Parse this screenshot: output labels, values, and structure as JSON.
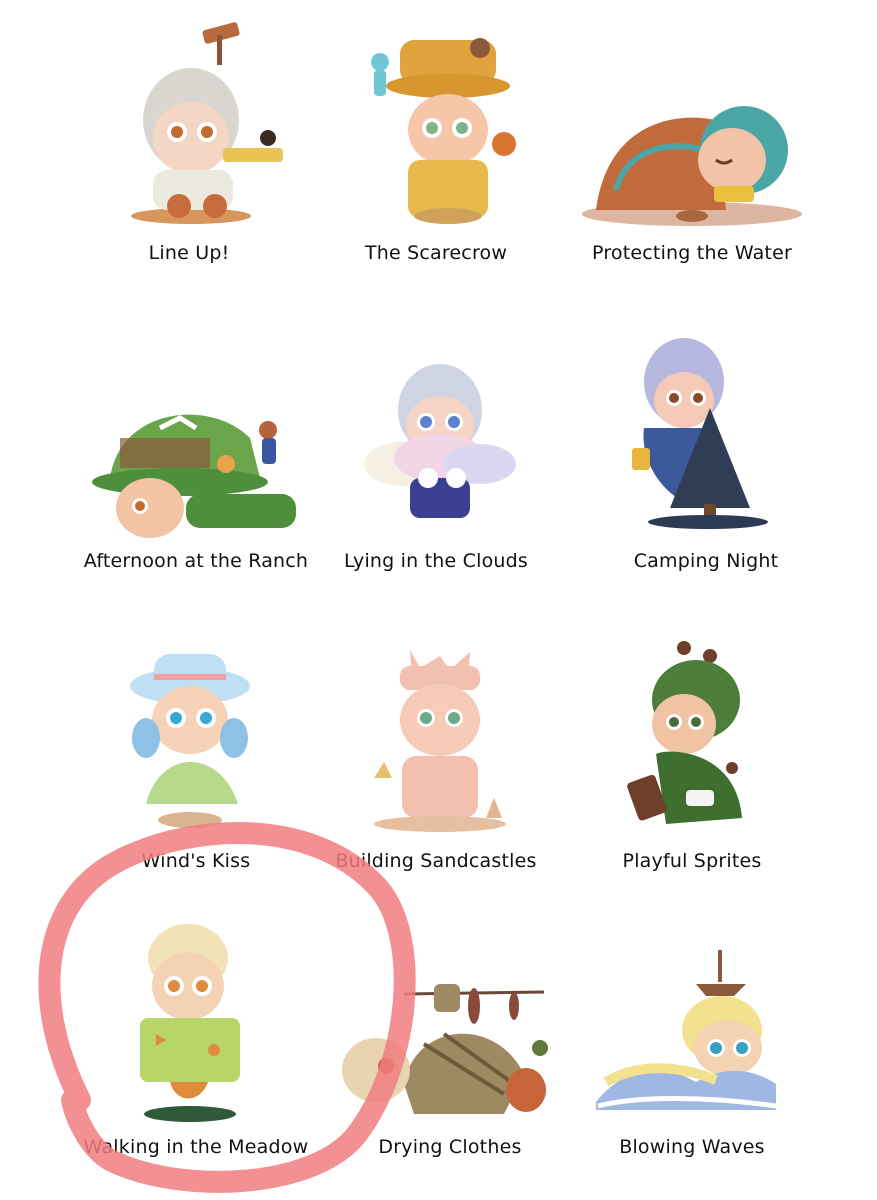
{
  "items": [
    {
      "label": "Line Up!",
      "figure": "line-up-figure",
      "colors": {
        "hair": "#d9d6cf",
        "body": "#eceadf",
        "accent": "#c46a2f"
      }
    },
    {
      "label": "The Scarecrow",
      "figure": "scarecrow-figure",
      "colors": {
        "hair": "#e0a23c",
        "body": "#e7b84b",
        "accent": "#8a6a3a"
      }
    },
    {
      "label": "Protecting the Water",
      "figure": "protecting-water-figure",
      "colors": {
        "hair": "#4aa7a6",
        "body": "#c16b3c",
        "accent": "#e9c13f"
      }
    },
    {
      "label": "Afternoon at the Ranch",
      "figure": "afternoon-ranch-figure",
      "colors": {
        "hair": "#6aa54b",
        "body": "#4f8f3c",
        "accent": "#8a5a3a"
      }
    },
    {
      "label": "Lying in the Clouds",
      "figure": "lying-clouds-figure",
      "colors": {
        "hair": "#cfd4e4",
        "body": "#f1d6e6",
        "accent": "#3b3f8f"
      }
    },
    {
      "label": "Camping Night",
      "figure": "camping-night-figure",
      "colors": {
        "hair": "#b7b8e0",
        "body": "#3c5a9a",
        "accent": "#2f3e55"
      }
    },
    {
      "label": "Wind's Kiss",
      "figure": "winds-kiss-figure",
      "colors": {
        "hair": "#bfe0f2",
        "body": "#b9d98a",
        "accent": "#8fc0e6"
      }
    },
    {
      "label": "Building Sandcastles",
      "figure": "building-sandcastles-figure",
      "colors": {
        "hair": "#f0b9a8",
        "body": "#f2c0ae",
        "accent": "#d9a36a"
      }
    },
    {
      "label": "Playful Sprites",
      "figure": "playful-sprites-figure",
      "colors": {
        "hair": "#4e7f3a",
        "body": "#3f6f30",
        "accent": "#6e3f2a"
      }
    },
    {
      "label": "Walking in the Meadow",
      "figure": "walking-meadow-figure",
      "colors": {
        "hair": "#f1e3b7",
        "body": "#b8d56a",
        "accent": "#e08a3b"
      }
    },
    {
      "label": "Drying Clothes",
      "figure": "drying-clothes-figure",
      "colors": {
        "hair": "#e9d3b0",
        "body": "#9e8a62",
        "accent": "#c7653a"
      }
    },
    {
      "label": "Blowing Waves",
      "figure": "blowing-waves-figure",
      "colors": {
        "hair": "#f2e28f",
        "body": "#9fb7e3",
        "accent": "#8a5a3a"
      }
    }
  ],
  "highlight": {
    "item": "Walking in the Meadow",
    "color": "#f07d80"
  }
}
